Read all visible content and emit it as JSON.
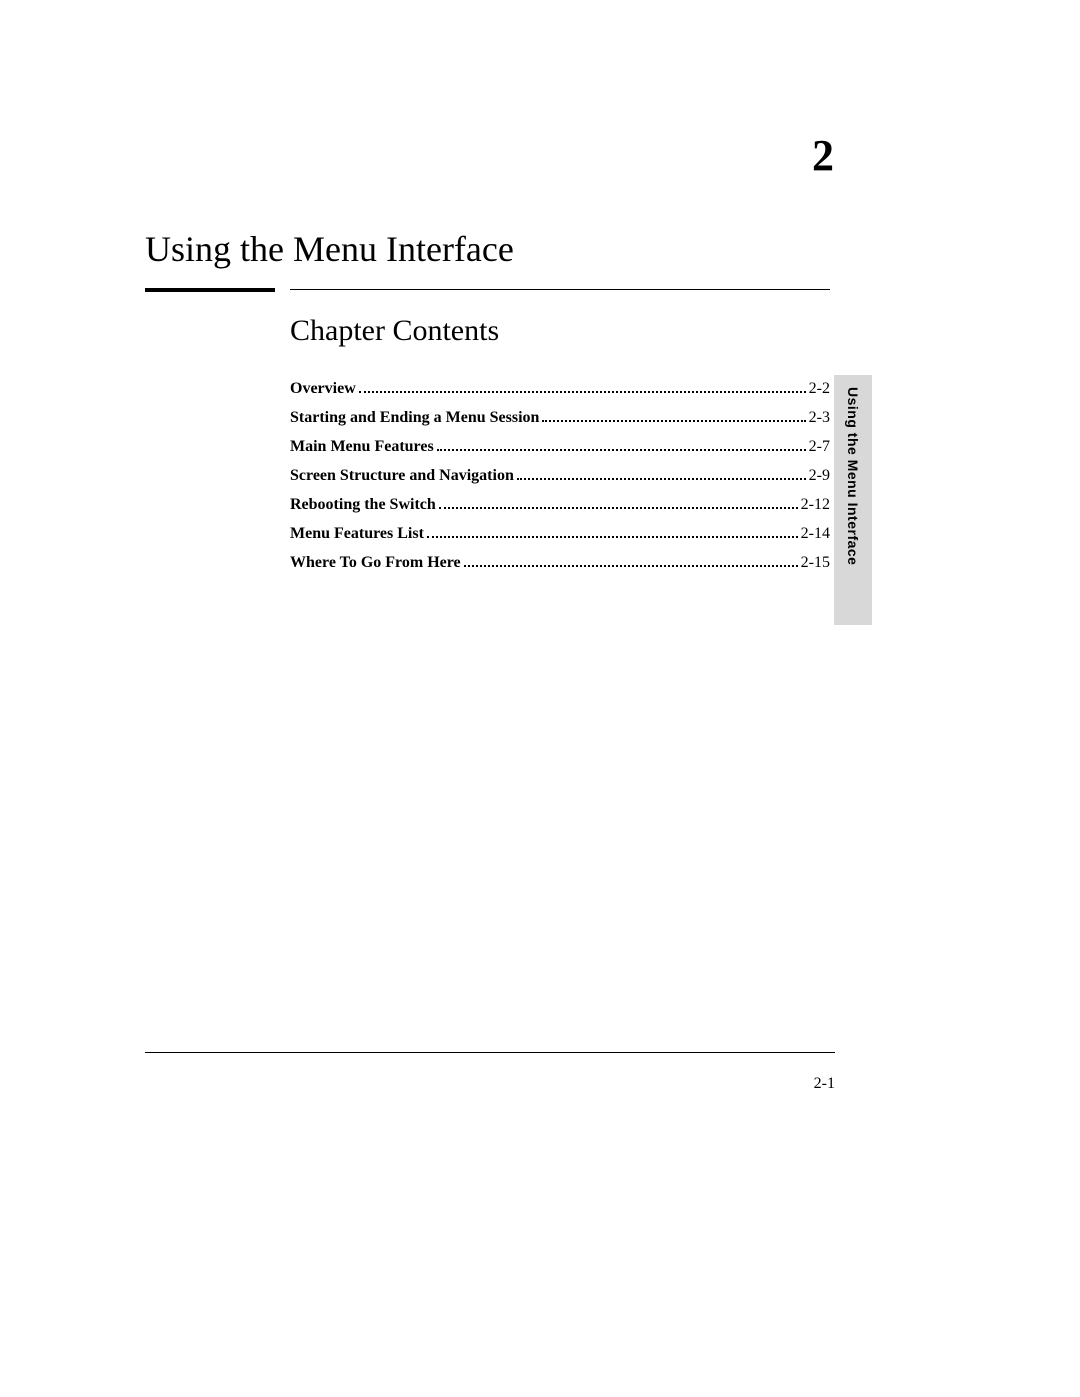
{
  "chapter_number": "2",
  "chapter_title": "Using the Menu Interface",
  "section_title": "Chapter Contents",
  "toc": [
    {
      "label": "Overview",
      "page": "2-2"
    },
    {
      "label": "Starting and Ending a Menu Session",
      "page": "2-3"
    },
    {
      "label": "Main Menu Features",
      "page": "2-7"
    },
    {
      "label": "Screen Structure and Navigation",
      "page": "2-9"
    },
    {
      "label": "Rebooting the Switch",
      "page": "2-12"
    },
    {
      "label": "Menu Features List",
      "page": "2-14"
    },
    {
      "label": "Where To Go From Here",
      "page": "2-15"
    }
  ],
  "side_tab": "Using the Menu Interface",
  "footer_page": "2-1"
}
